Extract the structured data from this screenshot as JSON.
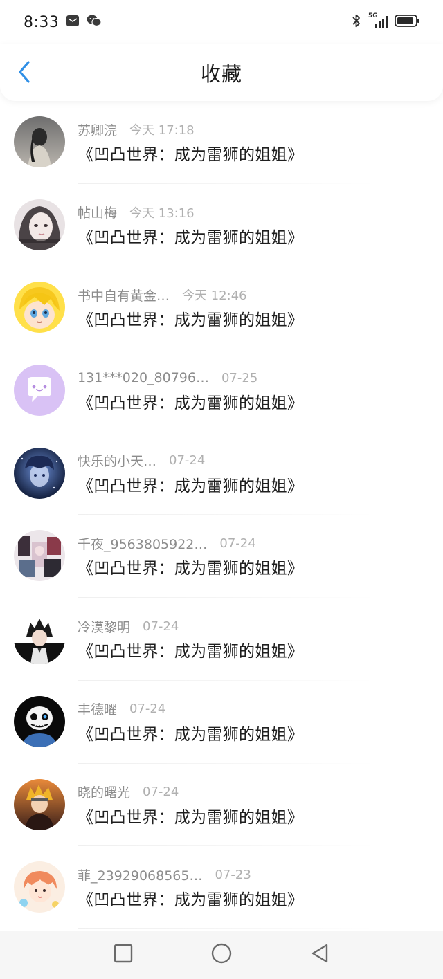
{
  "status_bar": {
    "time": "8:33",
    "network": "5G"
  },
  "header": {
    "title": "收藏"
  },
  "items": [
    {
      "user": "苏卿浣",
      "date": "今天 17:18",
      "book": "《凹凸世界：成为雷狮的姐姐》"
    },
    {
      "user": "帖山梅",
      "date": "今天 13:16",
      "book": "《凹凸世界：成为雷狮的姐姐》"
    },
    {
      "user": "书中自有黄金…",
      "date": "今天 12:46",
      "book": "《凹凸世界：成为雷狮的姐姐》"
    },
    {
      "user": "131***020_80796…",
      "date": "07-25",
      "book": "《凹凸世界：成为雷狮的姐姐》"
    },
    {
      "user": "快乐的小天…",
      "date": "07-24",
      "book": "《凹凸世界：成为雷狮的姐姐》"
    },
    {
      "user": "千夜_9563805922…",
      "date": "07-24",
      "book": "《凹凸世界：成为雷狮的姐姐》"
    },
    {
      "user": "冷漠黎明",
      "date": "07-24",
      "book": "《凹凸世界：成为雷狮的姐姐》"
    },
    {
      "user": "丰德曜",
      "date": "07-24",
      "book": "《凹凸世界：成为雷狮的姐姐》"
    },
    {
      "user": "晓的曙光",
      "date": "07-24",
      "book": "《凹凸世界：成为雷狮的姐姐》"
    },
    {
      "user": "菲_23929068565…",
      "date": "07-23",
      "book": "《凹凸世界：成为雷狮的姐姐》"
    }
  ],
  "colors": {
    "accent": "#2f8fe6",
    "username": "#8c8c8c",
    "date": "#b0b0b0",
    "book": "#1f1f1f"
  },
  "icons": {
    "back": "chevron-left-icon",
    "nav_recent": "square-icon",
    "nav_home": "circle-icon",
    "nav_back": "triangle-back-icon"
  }
}
